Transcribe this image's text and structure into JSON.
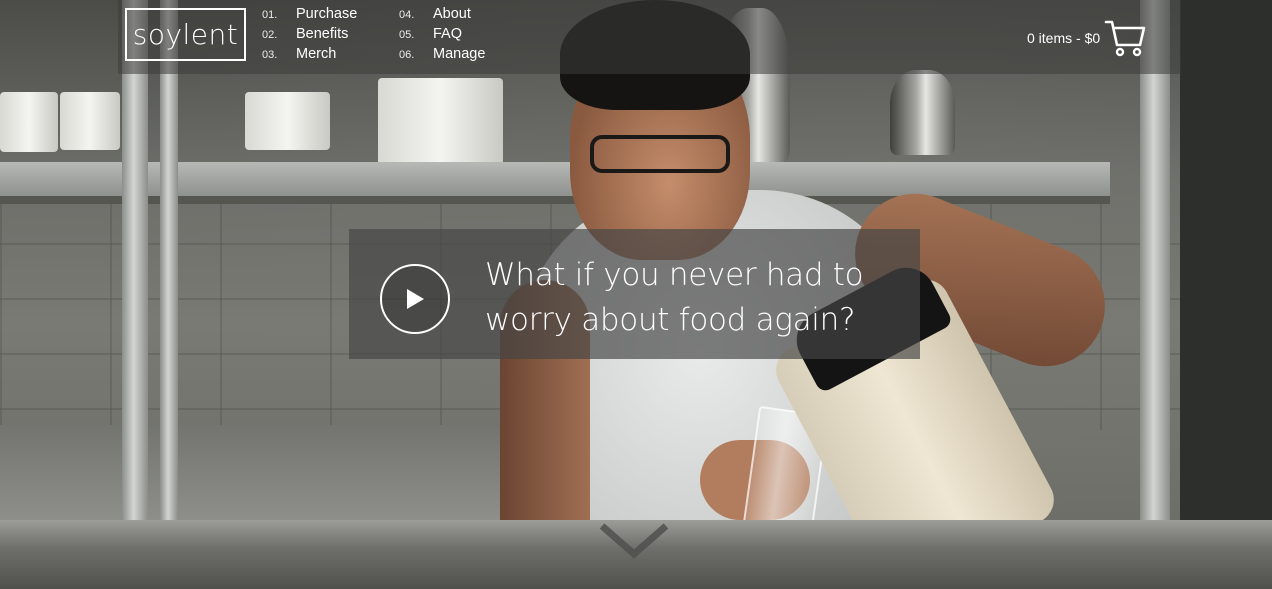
{
  "brand": {
    "logo_text": "soylent"
  },
  "nav": {
    "column_1": [
      {
        "num": "01.",
        "label": "Purchase"
      },
      {
        "num": "02.",
        "label": "Benefits"
      },
      {
        "num": "03.",
        "label": "Merch"
      }
    ],
    "column_2": [
      {
        "num": "04.",
        "label": "About"
      },
      {
        "num": "05.",
        "label": "FAQ"
      },
      {
        "num": "06.",
        "label": "Manage"
      }
    ]
  },
  "cart": {
    "summary": "0 items - $0",
    "icon": "cart-icon"
  },
  "hero": {
    "headline_line1": "What if you never had to",
    "headline_line2": "worry about food again?",
    "play_icon": "play-icon",
    "scroll_icon": "chevron-down-icon"
  },
  "colors": {
    "overlay": "#464646",
    "text": "#ffffff"
  }
}
